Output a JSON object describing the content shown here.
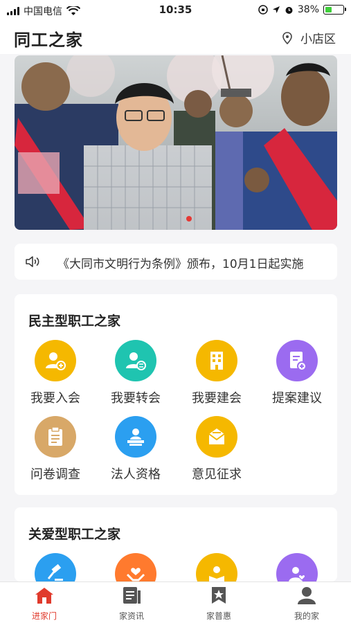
{
  "status_bar": {
    "carrier": "中国电信",
    "time": "10:35",
    "battery": "38%",
    "battery_level": 0.38
  },
  "header": {
    "title": "同工之家",
    "location": "小店区",
    "location_icon": "location-pin-icon"
  },
  "banner": {
    "active_index": 0
  },
  "notice": {
    "icon": "speaker-icon",
    "text": "《大同市文明行为条例》颁布，10月1日起实施"
  },
  "section1": {
    "title": "民主型职工之家",
    "items": [
      {
        "label": "我要入会",
        "icon": "add-user-icon",
        "color": "#f5b800"
      },
      {
        "label": "我要转会",
        "icon": "transfer-user-icon",
        "color": "#1fc4b0"
      },
      {
        "label": "我要建会",
        "icon": "building-icon",
        "color": "#f5b800"
      },
      {
        "label": "提案建议",
        "icon": "proposal-icon",
        "color": "#9b6bf0"
      },
      {
        "label": "问卷调查",
        "icon": "questionnaire-icon",
        "color": "#d8a868"
      },
      {
        "label": "法人资格",
        "icon": "legal-person-icon",
        "color": "#2b9ff0"
      },
      {
        "label": "意见征求",
        "icon": "mail-feedback-icon",
        "color": "#f5b800"
      }
    ]
  },
  "section2": {
    "title": "关爱型职工之家",
    "items": [
      {
        "icon": "gavel-icon",
        "color": "#2b9ff0"
      },
      {
        "icon": "care-hands-icon",
        "color": "#ff7a2e"
      },
      {
        "icon": "reading-icon",
        "color": "#f5b800"
      },
      {
        "icon": "heart-user-icon",
        "color": "#9b6bf0"
      }
    ]
  },
  "tabbar": {
    "tabs": [
      {
        "label": "进家门",
        "icon": "home-icon",
        "active": true
      },
      {
        "label": "家资讯",
        "icon": "news-icon",
        "active": false
      },
      {
        "label": "家普惠",
        "icon": "star-bookmark-icon",
        "active": false
      },
      {
        "label": "我的家",
        "icon": "profile-icon",
        "active": false
      }
    ],
    "active_color": "#e03a2c"
  }
}
